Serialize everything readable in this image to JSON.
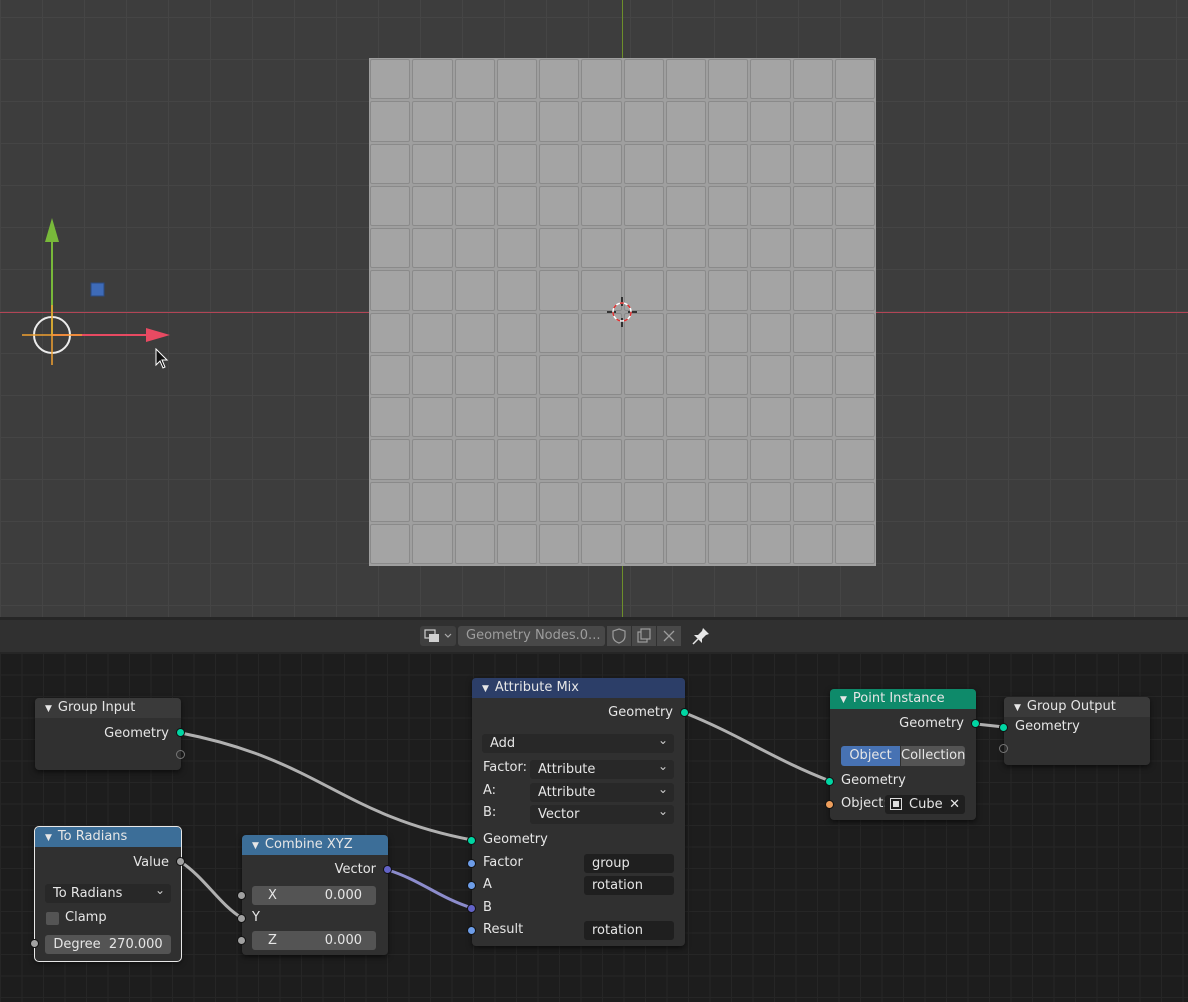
{
  "header": {
    "node_group_name": "Geometry Nodes.0...",
    "fake_user_icon": "shield-icon",
    "duplicate_icon": "duplicate-icon",
    "unlink_icon": "close-icon",
    "pin_icon": "pin-icon"
  },
  "nodes": {
    "group_input": {
      "title": "Group Input",
      "output": "Geometry"
    },
    "to_radians": {
      "title": "To Radians",
      "output": "Value",
      "operation": "To Radians",
      "clamp_label": "Clamp",
      "clamp": false,
      "degree_label": "Degree",
      "degree_value": "270.000"
    },
    "combine_xyz": {
      "title": "Combine XYZ",
      "output": "Vector",
      "x_label": "X",
      "x_value": "0.000",
      "y_label": "Y",
      "z_label": "Z",
      "z_value": "0.000"
    },
    "attribute_mix": {
      "title": "Attribute Mix",
      "output": "Geometry",
      "blend": "Add",
      "factor_label": "Factor:",
      "factor_type": "Attribute",
      "a_label": "A:",
      "a_type": "Attribute",
      "b_label": "B:",
      "b_type": "Vector",
      "in_geometry": "Geometry",
      "in_factor": "Factor",
      "in_factor_value": "group",
      "in_a": "A",
      "in_a_value": "rotation",
      "in_b": "B",
      "in_result": "Result",
      "in_result_value": "rotation"
    },
    "point_instance": {
      "title": "Point Instance",
      "output": "Geometry",
      "mode_object": "Object",
      "mode_collection": "Collection",
      "in_geometry": "Geometry",
      "object_label": "Object:",
      "object_value": "Cube"
    },
    "group_output": {
      "title": "Group Output",
      "input": "Geometry"
    }
  },
  "colors": {
    "geometry_socket": "#00d6a3",
    "float_socket": "#a1a1a1",
    "vector_socket": "#6363c7",
    "attribute_socket": "#6d9de8",
    "object_socket": "#ed9e5c",
    "input_header": "#3a3a3a",
    "converter_header": "#3c6e98",
    "attribute_header": "#2c3e68",
    "geometry_header": "#0e8a6a",
    "x_axis": "#b24556",
    "y_axis": "#6d8f2a"
  }
}
